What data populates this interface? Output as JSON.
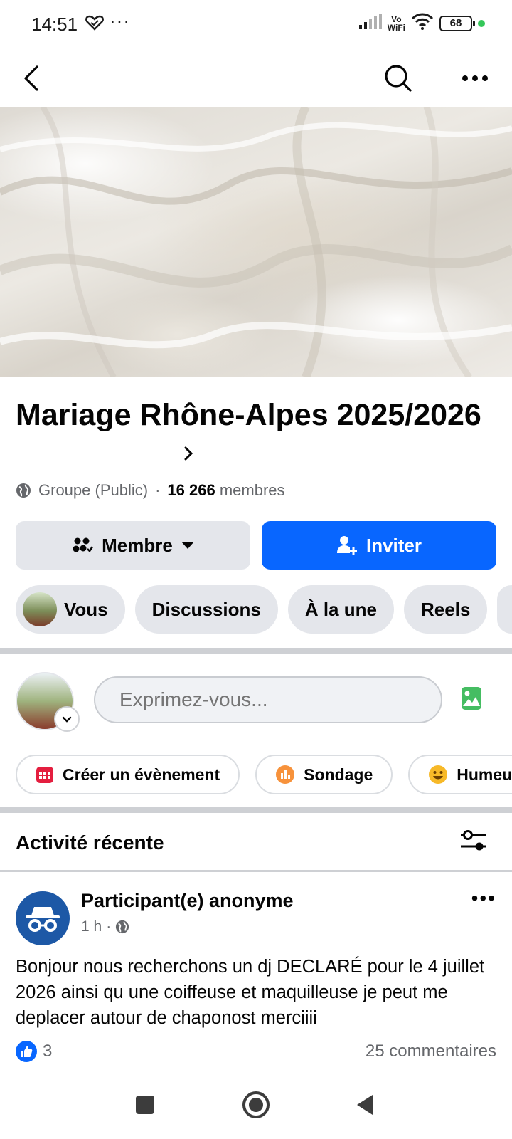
{
  "status_bar": {
    "time": "14:51",
    "more": "···",
    "vo_wifi_line1": "Vo",
    "vo_wifi_line2": "WiFi",
    "battery": "68"
  },
  "top_nav": {
    "back_icon": "chevron-left-icon",
    "search_icon": "search-icon",
    "more_icon": "more-horizontal-icon"
  },
  "group": {
    "title": "Mariage Rhône-Alpes 2025/2026",
    "type": "Groupe (Public)",
    "separator": "·",
    "members_count": "16 266",
    "members_label": "membres"
  },
  "buttons": {
    "member_label": "Membre",
    "invite_label": "Inviter"
  },
  "tabs": [
    {
      "label": "Vous"
    },
    {
      "label": "Discussions"
    },
    {
      "label": "À la une"
    },
    {
      "label": "Reels"
    }
  ],
  "composer": {
    "placeholder": "Exprimez-vous..."
  },
  "actions": [
    {
      "label": "Créer un évènement",
      "icon": "calendar-icon",
      "color": "#e41e3f"
    },
    {
      "label": "Sondage",
      "icon": "poll-icon",
      "color": "#f7923b"
    },
    {
      "label": "Humeu",
      "icon": "smile-icon",
      "color": "#f7b928"
    }
  ],
  "recent": {
    "title": "Activité récente"
  },
  "post": {
    "author": "Participant(e) anonyme",
    "time": "1 h",
    "separator": "·",
    "more": "•••",
    "text": "Bonjour nous recherchons un dj DECLARÉ  pour le 4 juillet 2026 ainsi qu une coiffeuse et maquilleuse je peut me deplacer autour de chaponost merciiii",
    "likes": "3",
    "comments": "25 commentaires"
  },
  "colors": {
    "primary": "#0866ff",
    "chip_bg": "#e4e6eb",
    "secondary_text": "#65676b"
  }
}
